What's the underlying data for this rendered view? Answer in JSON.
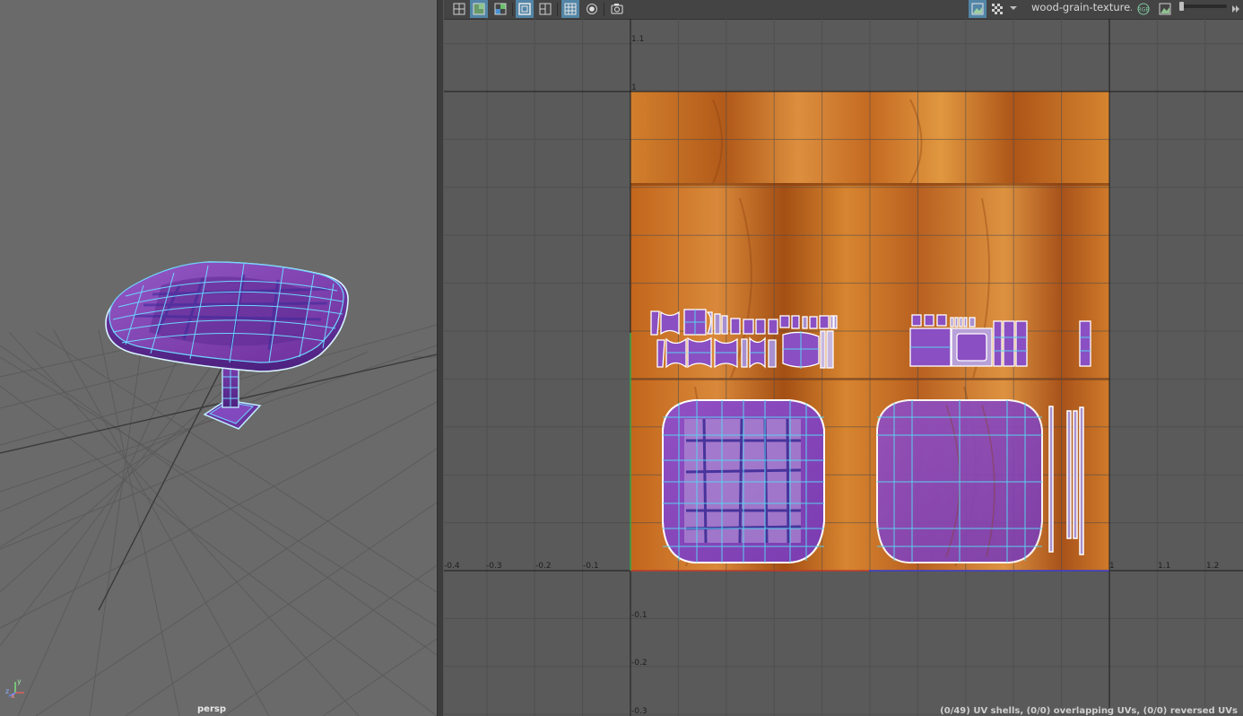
{
  "perspective_view": {
    "camera_label": "persp",
    "axis_labels": {
      "x": "x",
      "y": "y",
      "z": "z"
    },
    "colors": {
      "background": "#6a6a6a",
      "grid": "#585858",
      "mesh_wire": "#6fd4ff",
      "mesh_fill": "#7b3fa8"
    }
  },
  "uv_editor": {
    "toolbar": {
      "icons": [
        "uv-grid-icon",
        "shaded-uv-icon",
        "distortion-icon",
        "frame-border-icon",
        "tile-grid-icon",
        "pixel-grid-icon",
        "isolate-icon",
        "snapshot-icon",
        "image-display-icon",
        "checker-icon",
        "dropdown-arrow-icon",
        "rgb-channels-icon",
        "image-ratio-icon"
      ],
      "texture_name": "wood-grain-texture.jpg",
      "rgb_label": "RGB"
    },
    "axis": {
      "u_labels": [
        "-0.4",
        "-0.3",
        "-0.2",
        "-0.1",
        "1",
        "1.1",
        "1.2"
      ],
      "v_labels": [
        "1.1",
        "1",
        "-0.1",
        "-0.2",
        "-0.3"
      ]
    },
    "status_text": "(0/49) UV shells, (0/0) overlapping UVs, (0/0) reversed UVs",
    "colors": {
      "background": "#5a5a5a",
      "grid": "#4c4c4c",
      "wood_light": "#d07d2a",
      "wood_dark": "#8a3d0d",
      "uv_fill": "#8848c0",
      "uv_edge": "#ffffff",
      "uv_wire": "#55c8ee",
      "u_axis": "#c0392b",
      "v_axis": "#2fa84a"
    }
  }
}
